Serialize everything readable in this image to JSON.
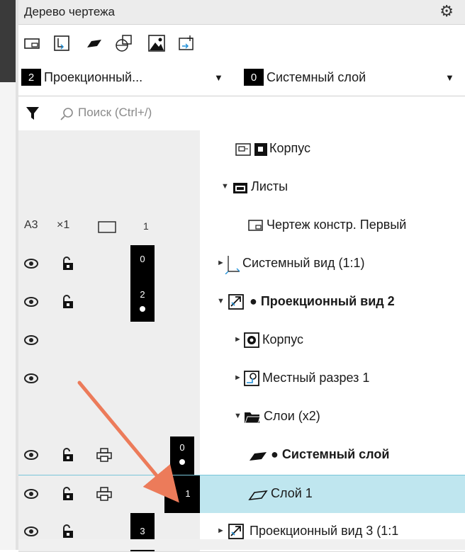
{
  "panel": {
    "title": "Дерево чертежа",
    "settings_icon": "gear-icon"
  },
  "toolbar": {
    "tools": [
      "view-icon",
      "local-view-icon",
      "layer-icon",
      "section-icon",
      "image-icon",
      "detail-view-icon"
    ]
  },
  "view_combo": {
    "number": "2",
    "label": "Проекционный...",
    "arrow": "▼"
  },
  "layer_combo": {
    "number": "0",
    "label": "Системный слой",
    "arrow": "▼"
  },
  "search": {
    "placeholder": "Поиск (Ctrl+/)",
    "filter_icon": "filter-icon",
    "search_icon": "magnifier-icon"
  },
  "tree": {
    "r0": {
      "label": "Корпус"
    },
    "r1": {
      "label": "Листы",
      "toggle": "▼"
    },
    "r2": {
      "format": "A3",
      "scale": "×1",
      "sheet": "1",
      "label": "Чертеж констр. Первый"
    },
    "r3": {
      "layer": "0",
      "toggle": "►",
      "label": "Системный вид (1:1)"
    },
    "r4": {
      "layer": "2",
      "toggle": "▼",
      "label": "● Проекционный вид 2"
    },
    "r5": {
      "toggle": "►",
      "label": "Корпус"
    },
    "r6": {
      "toggle": "►",
      "label": "Местный разрез 1"
    },
    "r7": {
      "toggle": "▼",
      "label": "Слои (x2)"
    },
    "r8": {
      "layer": "0",
      "label": "● Системный слой"
    },
    "r9": {
      "layer": "1",
      "label": "Слой 1"
    },
    "r10": {
      "layer": "3",
      "toggle": "►",
      "label": "Проекционный вид 3 (1:1"
    }
  },
  "annotation": {
    "color": "#ec7b5a"
  },
  "colors": {
    "selection": "#bfe6ef",
    "badge": "#000000"
  }
}
